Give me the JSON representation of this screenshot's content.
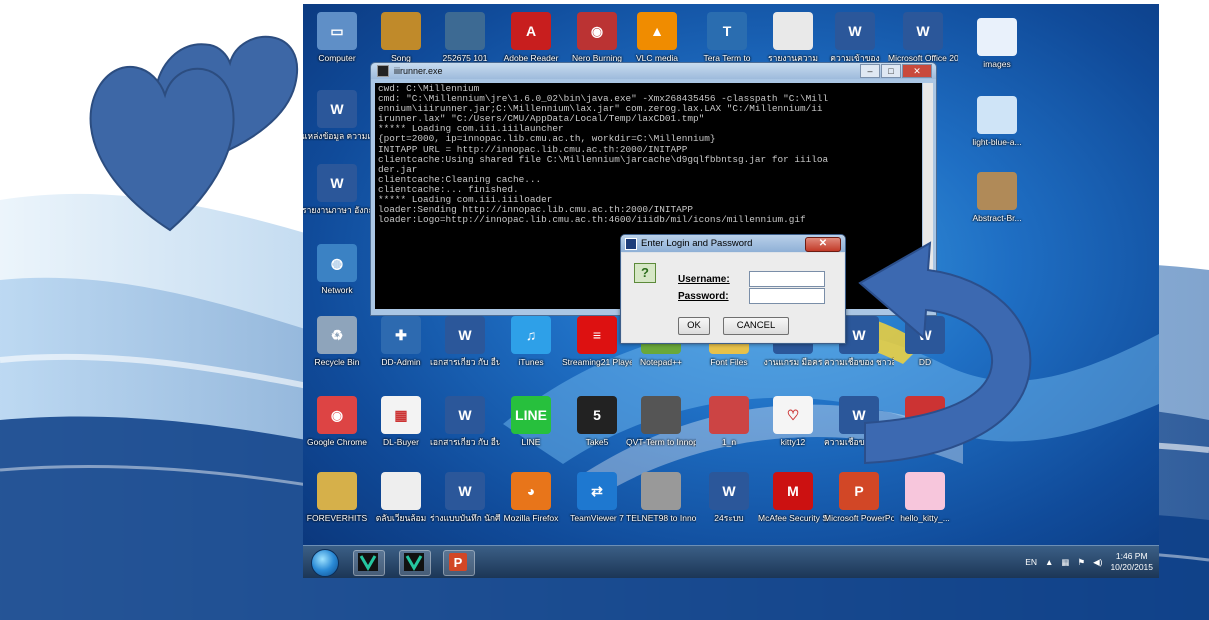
{
  "desktop_icons": [
    {
      "id": "computer",
      "label": "Computer",
      "color": "#5f8fc7",
      "glyph": "▭"
    },
    {
      "id": "song",
      "label": "Song",
      "color": "#c08a2a",
      "glyph": ""
    },
    {
      "id": "f252675",
      "label": "252675 101",
      "color": "#3d6a93",
      "glyph": ""
    },
    {
      "id": "adobe",
      "label": "Adobe Reader",
      "color": "#c81e1e",
      "glyph": "A"
    },
    {
      "id": "nero",
      "label": "Nero Burning",
      "color": "#b33",
      "glyph": "◉"
    },
    {
      "id": "vlc",
      "label": "VLC media",
      "color": "#f08c00",
      "glyph": "▲"
    },
    {
      "id": "teraterm",
      "label": "Tera Term to",
      "color": "#2a6db0",
      "glyph": "T"
    },
    {
      "id": "doc1",
      "label": "รายงานความ",
      "color": "#e9e9e9",
      "glyph": ""
    },
    {
      "id": "word1",
      "label": "ความเข้าของ",
      "color": "#2b579a",
      "glyph": "W"
    },
    {
      "id": "msoffice",
      "label": "Microsoft Office 2010",
      "color": "#2b579a",
      "glyph": "W"
    },
    {
      "id": "images",
      "label": "images",
      "color": "#e9f1fb",
      "glyph": ""
    },
    {
      "id": "thai1",
      "label": "แหล่งข้อมูล ความเชื่อ",
      "color": "#2b579a",
      "glyph": "W"
    },
    {
      "id": "lightblue",
      "label": "light-blue-a...",
      "color": "#cfe4f7",
      "glyph": ""
    },
    {
      "id": "thai2",
      "label": "รายงานภาษา อังกฤษ",
      "color": "#2b579a",
      "glyph": "W"
    },
    {
      "id": "abstract",
      "label": "Abstract-Br...",
      "color": "#b08a58",
      "glyph": ""
    },
    {
      "id": "network",
      "label": "Network",
      "color": "#3b82c4",
      "glyph": "◍"
    },
    {
      "id": "recycle",
      "label": "Recycle Bin",
      "color": "#8ea4bb",
      "glyph": "♻"
    },
    {
      "id": "ddadmin",
      "label": "DD-Admin",
      "color": "#2d6ab0",
      "glyph": "✚"
    },
    {
      "id": "thai3",
      "label": "เอกสารเกี่ยว กับ อื่น ๆ",
      "color": "#2b579a",
      "glyph": "W"
    },
    {
      "id": "itunes",
      "label": "iTunes",
      "color": "#2ea0e8",
      "glyph": "♫"
    },
    {
      "id": "streaming",
      "label": "Streaming21 Player 5.0",
      "color": "#d11",
      "glyph": "≡"
    },
    {
      "id": "notepad",
      "label": "Notepad++",
      "color": "#69a83a",
      "glyph": ""
    },
    {
      "id": "fontfiles",
      "label": "Font Files",
      "color": "#e7c14a",
      "glyph": ""
    },
    {
      "id": "thai4",
      "label": "งานแกรม มือคร",
      "color": "#2b579a",
      "glyph": "W"
    },
    {
      "id": "thai5",
      "label": "ความเชื่อของ ชาวล้านนา ...",
      "color": "#2b579a",
      "glyph": "W"
    },
    {
      "id": "dd",
      "label": "DD",
      "color": "#2b579a",
      "glyph": "W"
    },
    {
      "id": "chrome",
      "label": "Google Chrome",
      "color": "#d44",
      "glyph": "◉"
    },
    {
      "id": "dlbuyer",
      "label": "DL-Buyer",
      "color": "#f3f3f3",
      "glyph": "▦"
    },
    {
      "id": "thai6",
      "label": "เอกสารเกี่ยว กับ อื่น ๆ",
      "color": "#2b579a",
      "glyph": "W"
    },
    {
      "id": "line",
      "label": "LINE",
      "color": "#27c03d",
      "glyph": "LINE"
    },
    {
      "id": "take5",
      "label": "Take5",
      "color": "#222",
      "glyph": "5"
    },
    {
      "id": "qvt",
      "label": "QVT-Term to Innopac",
      "color": "#555",
      "glyph": ""
    },
    {
      "id": "one_n",
      "label": "1_n",
      "color": "#c44",
      "glyph": ""
    },
    {
      "id": "kitty12",
      "label": "kitty12",
      "color": "#f5f5f5",
      "glyph": "♡"
    },
    {
      "id": "thai7",
      "label": "ความเชื่อของ ชาวล้านนา ...",
      "color": "#2b579a",
      "glyph": "W"
    },
    {
      "id": "redgift",
      "label": "red-gift-bo...",
      "color": "#c33",
      "glyph": ""
    },
    {
      "id": "foreverhits",
      "label": "FOREVERHITS",
      "color": "#d6b04a",
      "glyph": ""
    },
    {
      "id": "thai8",
      "label": "ตลับเวียนล้อม",
      "color": "#eee",
      "glyph": ""
    },
    {
      "id": "thai9",
      "label": "ร่างแบบบันทึก นักศึกษา",
      "color": "#2b579a",
      "glyph": "W"
    },
    {
      "id": "firefox",
      "label": "Mozilla Firefox",
      "color": "#e8751a",
      "glyph": "◕"
    },
    {
      "id": "teamviewer",
      "label": "TeamViewer 7",
      "color": "#1e78d0",
      "glyph": "⇄"
    },
    {
      "id": "telnet",
      "label": "TELNET98 to Innopac",
      "color": "#999",
      "glyph": ""
    },
    {
      "id": "thai10",
      "label": "24ระบบ",
      "color": "#2b579a",
      "glyph": "W"
    },
    {
      "id": "mcafee",
      "label": "McAfee Security Sc...",
      "color": "#c11",
      "glyph": "M"
    },
    {
      "id": "powerpoint",
      "label": "Microsoft PowerPoi...",
      "color": "#d24726",
      "glyph": "P"
    },
    {
      "id": "hellokitty",
      "label": "hello_kitty_...",
      "color": "#f7c6dc",
      "glyph": ""
    }
  ],
  "console": {
    "title": "iiirunner.exe",
    "lines": [
      "cwd: C:\\Millennium",
      "cmd: \"C:\\Millennium\\jre\\1.6.0_02\\bin\\java.exe\" -Xmx268435456 -classpath \"C:\\Mill",
      "ennium\\iiirunner.jar;C:\\Millennium\\lax.jar\" com.zerog.lax.LAX \"C:/Millennium/ii",
      "irunner.lax\" \"C:/Users/CMU/AppData/Local/Temp/laxCD01.tmp\"",
      "***** Loading com.iii.iiilauncher",
      "{port=2000, ip=innopac.lib.cmu.ac.th, workdir=C:\\Millennium}",
      "INITAPP URL = http://innopac.lib.cmu.ac.th:2000/INITAPP",
      "clientcache:Using shared file C:\\Millennium\\jarcache\\d9gqlfbbntsg.jar for iiiloa",
      "der.jar",
      "clientcache:Cleaning cache...",
      "clientcache:... finished.",
      "***** Loading com.iii.iiiloader",
      "loader:Sending http://innopac.lib.cmu.ac.th:2000/INITAPP",
      "loader:Logo=http://innopac.lib.cmu.ac.th:4600/iiidb/mil/icons/millennium.gif"
    ]
  },
  "login": {
    "title": "Enter Login and Password",
    "icon": "?",
    "username_label": "Username:",
    "password_label": "Password:",
    "username_value": "",
    "password_value": "",
    "ok_label": "OK",
    "cancel_label": "CANCEL",
    "close_glyph": "✕"
  },
  "taskbar": {
    "language": "EN",
    "time": "1:46 PM",
    "date": "10/20/2015"
  },
  "colors": {
    "heart": "#3d67a6",
    "heart_outline": "#2c4d80",
    "arrow": "#3c69b1",
    "desktop_blue": "#1f6fc4"
  }
}
